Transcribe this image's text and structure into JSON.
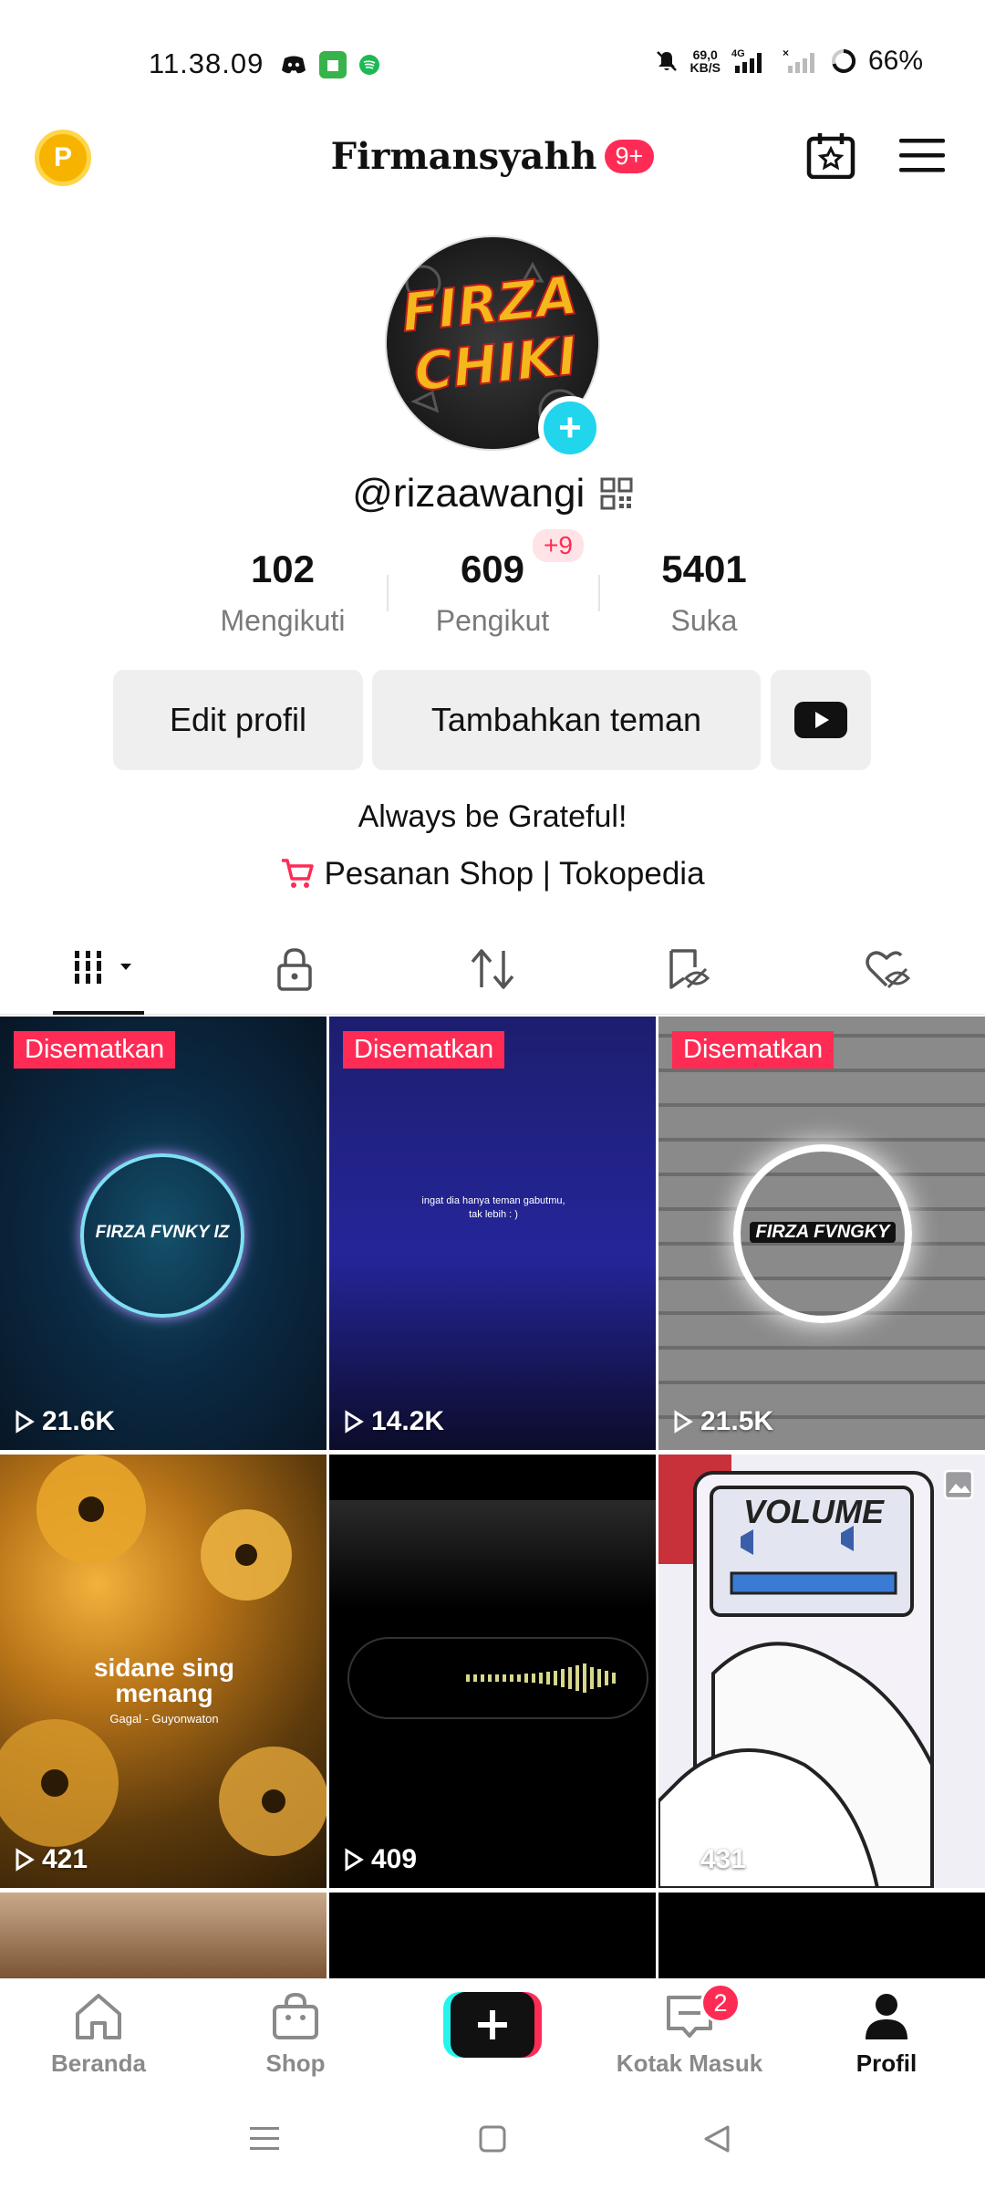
{
  "status_bar": {
    "time": "11.38.09",
    "net_speed_value": "69,0",
    "net_speed_unit": "KB/S",
    "network": "4G",
    "battery": "66%"
  },
  "header": {
    "coin_letter": "P",
    "username": "Firmansyahh",
    "notification_badge": "9+"
  },
  "profile": {
    "handle": "@rizaawangi",
    "avatar_text": "FIRZA CHIKI",
    "stats": [
      {
        "value": "102",
        "label": "Mengikuti"
      },
      {
        "value": "609",
        "label": "Pengikut"
      },
      {
        "value": "5401",
        "label": "Suka"
      }
    ],
    "followers_new": "+9",
    "bio": "Always be Grateful!",
    "shop_link": "Pesanan Shop | Tokopedia"
  },
  "buttons": {
    "edit_profile": "Edit profil",
    "add_friends": "Tambahkan teman"
  },
  "videos": [
    {
      "pinned": "Disematkan",
      "views": "21.6K",
      "overlay": "FIRZA FVNKY IZ"
    },
    {
      "pinned": "Disematkan",
      "views": "14.2K",
      "overlay": "ingat dia hanya teman gabutmu, tak lebih : )"
    },
    {
      "pinned": "Disematkan",
      "views": "21.5K",
      "overlay": "FIRZA FVNGKY"
    },
    {
      "pinned": "",
      "views": "421",
      "overlay": "sidane sing menang",
      "overlay_sub": "Gagal - Guyonwaton"
    },
    {
      "pinned": "",
      "views": "409",
      "overlay": ""
    },
    {
      "pinned": "",
      "views": "431",
      "overlay": "VOLUME"
    }
  ],
  "bottom_nav": {
    "home": "Beranda",
    "shop": "Shop",
    "inbox": "Kotak Masuk",
    "inbox_badge": "2",
    "profile": "Profil"
  },
  "colors": {
    "accent": "#fe2c55",
    "cyan": "#20d5ec",
    "coin": "#f6b400"
  }
}
